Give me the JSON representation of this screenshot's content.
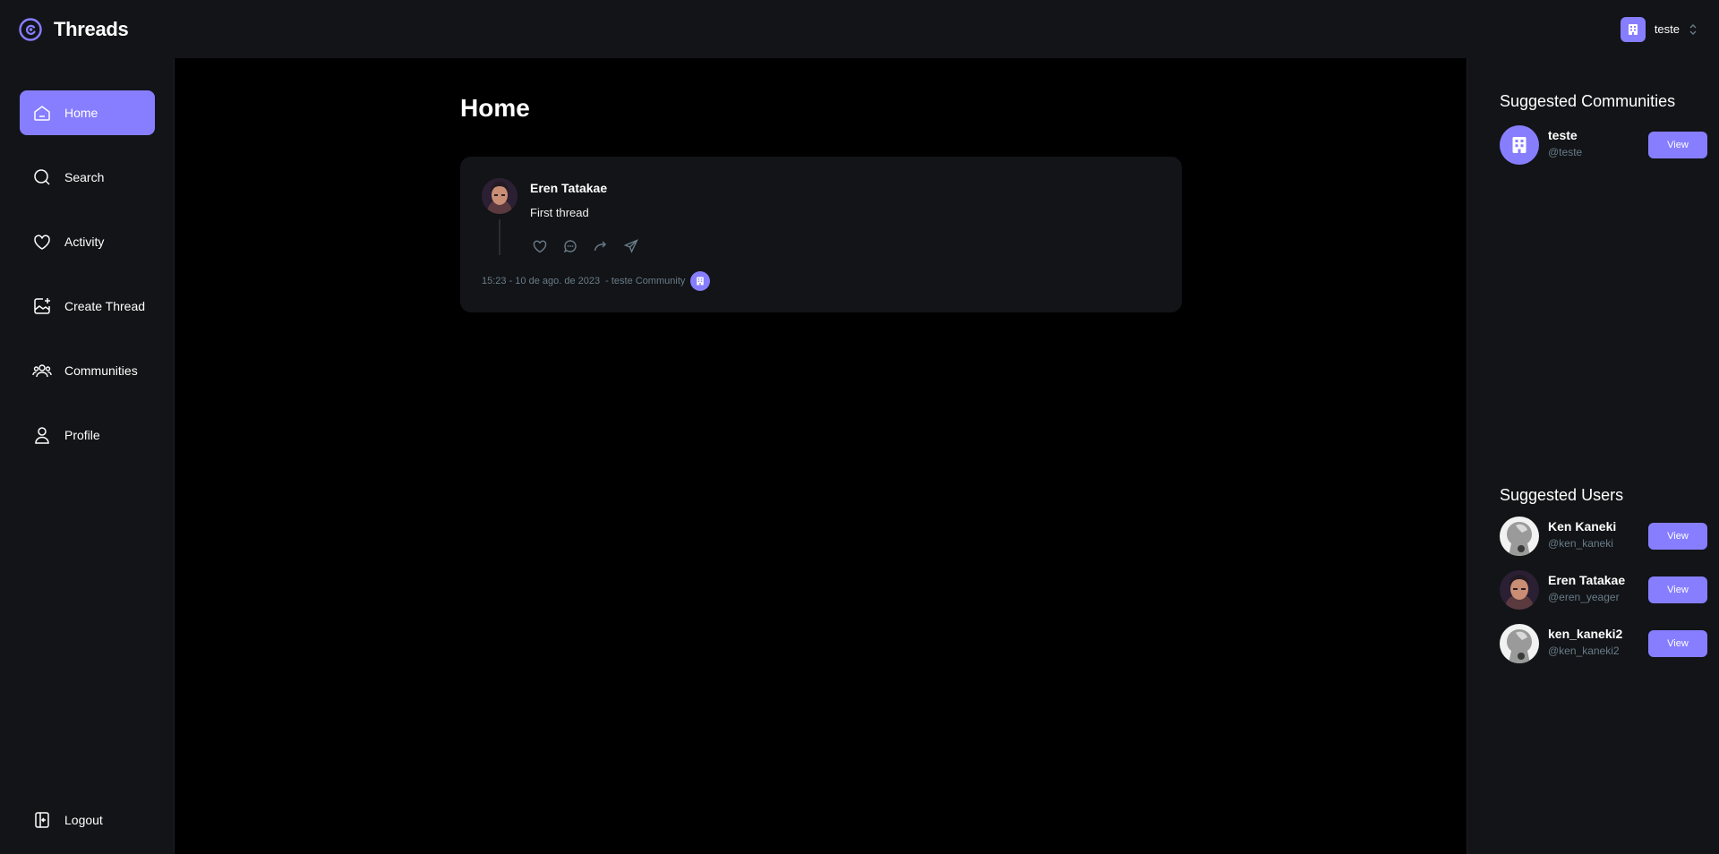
{
  "app": {
    "name": "Threads"
  },
  "org": {
    "name": "teste"
  },
  "colors": {
    "accent": "#877eff",
    "panel": "#121417",
    "muted": "#697c89",
    "background": "#000000"
  },
  "sidebar": {
    "items": [
      {
        "label": "Home",
        "icon": "home-icon",
        "active": true
      },
      {
        "label": "Search",
        "icon": "search-icon",
        "active": false
      },
      {
        "label": "Activity",
        "icon": "heart-icon",
        "active": false
      },
      {
        "label": "Create Thread",
        "icon": "create-icon",
        "active": false
      },
      {
        "label": "Communities",
        "icon": "communities-icon",
        "active": false
      },
      {
        "label": "Profile",
        "icon": "user-icon",
        "active": false
      }
    ],
    "logout_label": "Logout"
  },
  "main": {
    "title": "Home",
    "threads": [
      {
        "author": "Eren Tatakae",
        "text": "First thread",
        "timestamp": "15:23 - 10 de ago. de 2023",
        "community": "- teste Community",
        "actions": [
          "heart-icon",
          "reply-icon",
          "repost-icon",
          "share-icon"
        ]
      }
    ]
  },
  "right": {
    "communities_title": "Suggested Communities",
    "communities": [
      {
        "name": "teste",
        "handle": "@teste",
        "button": "View"
      }
    ],
    "users_title": "Suggested Users",
    "users": [
      {
        "name": "Ken Kaneki",
        "handle": "@ken_kaneki",
        "button": "View"
      },
      {
        "name": "Eren Tatakae",
        "handle": "@eren_yeager",
        "button": "View"
      },
      {
        "name": "ken_kaneki2",
        "handle": "@ken_kaneki2",
        "button": "View"
      }
    ]
  }
}
